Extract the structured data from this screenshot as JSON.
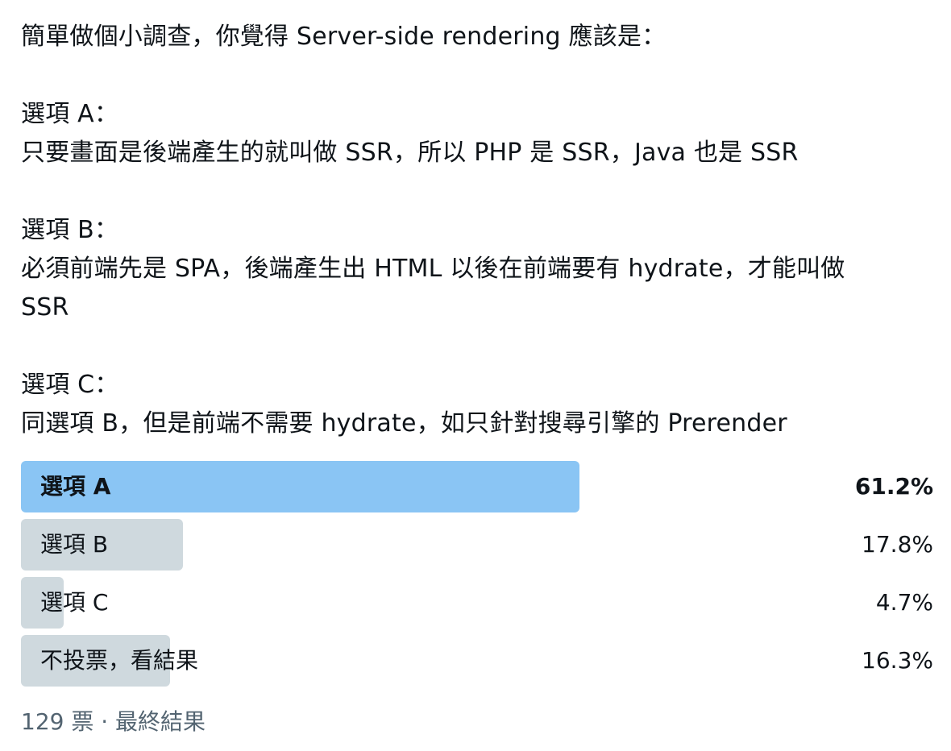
{
  "tweet": {
    "lines": [
      "簡單做個小調查，你覺得 Server-side rendering 應該是：",
      "",
      "選項 A：",
      "只要畫面是後端產生的就叫做 SSR，所以 PHP 是 SSR，Java 也是 SSR",
      "",
      "選項 B：",
      "必須前端先是 SPA，後端產生出 HTML 以後在前端要有 hydrate，才能叫做",
      "SSR",
      "",
      "選項 C：",
      "同選項 B，但是前端不需要 hydrate，如只針對搜尋引擎的 Prerender"
    ]
  },
  "poll": {
    "options": [
      {
        "label": "選項 A",
        "percent": "61.2%",
        "fraction": 0.612,
        "winner": true
      },
      {
        "label": "選項 B",
        "percent": "17.8%",
        "fraction": 0.178,
        "winner": false
      },
      {
        "label": "選項 C",
        "percent": "4.7%",
        "fraction": 0.047,
        "winner": false
      },
      {
        "label": "不投票，看結果",
        "percent": "16.3%",
        "fraction": 0.163,
        "winner": false
      }
    ],
    "footer": "129 票 · 最終結果"
  },
  "colors": {
    "text": "#0f1419",
    "secondary_text": "#536471",
    "winner_bar": "#8ac5f4",
    "other_bar": "#cfd9de"
  }
}
